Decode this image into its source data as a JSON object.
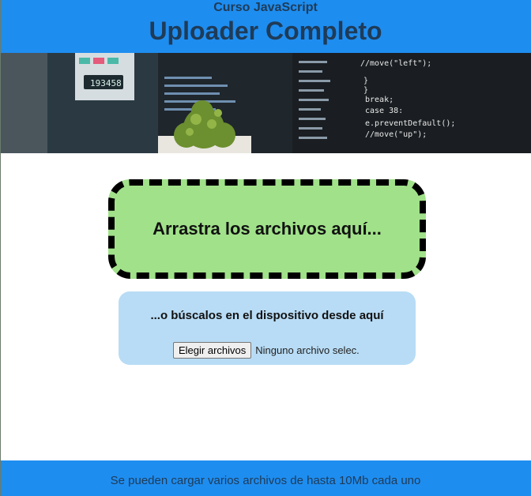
{
  "header": {
    "course": "Curso JavaScript",
    "title": "Uploader Completo"
  },
  "banner": {
    "code_lines": [
      "//move(\"left\");",
      "}",
      "}",
      "break;",
      "case 38:",
      "e.preventDefault();",
      "//move(\"up\");"
    ],
    "counter": "193458"
  },
  "dropzone": {
    "text": "Arrastra los archivos aquí..."
  },
  "picker": {
    "label": "...o búscalos en el dispositivo desde aquí",
    "button": "Elegir archivos",
    "status": "Ninguno archivo selec."
  },
  "footer": {
    "text": "Se pueden cargar varios archivos de hasta 10Mb cada uno"
  },
  "colors": {
    "header_bg": "#1e8df0",
    "dropzone_bg": "#a1e18a",
    "picker_bg": "#b8dcf5",
    "text_dark": "#1f3b57"
  }
}
